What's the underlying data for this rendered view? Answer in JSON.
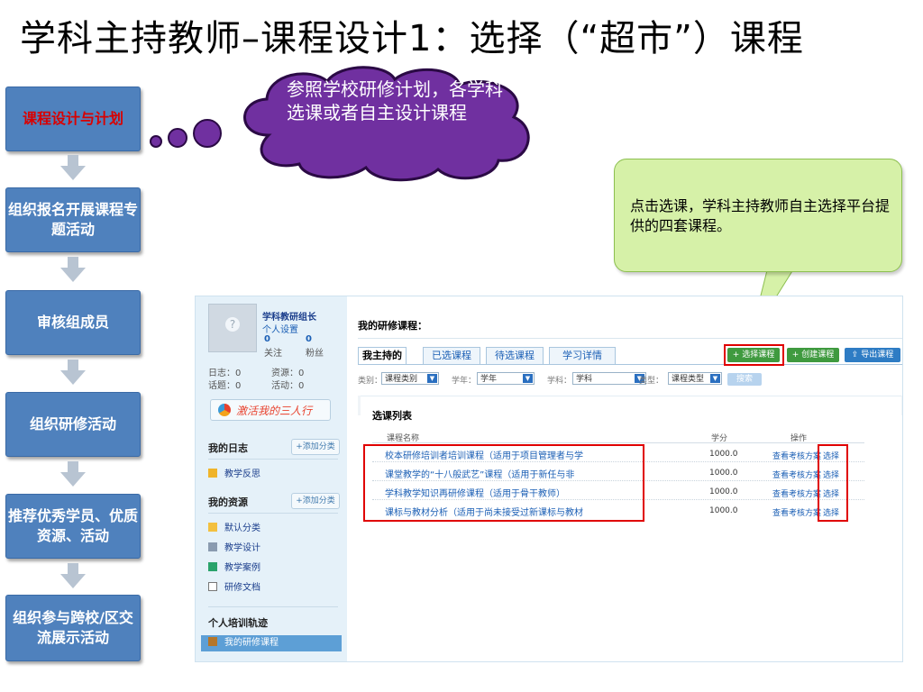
{
  "title": "学科主持教师–课程设计1：选择（“超市”）课程",
  "flow": [
    {
      "label": "课程设计与计划"
    },
    {
      "label": "组织报名开展课程专题活动"
    },
    {
      "label": "审核组成员"
    },
    {
      "label": "组织研修活动"
    },
    {
      "label": "推荐优秀学员、优质资源、活动"
    },
    {
      "label": "组织参与跨校/区交流展示活动"
    }
  ],
  "cloud_text": "参照学校研修计划，各学科选课或者自主设计课程",
  "callout_text": "点击选课，学科主持教师自主选择平台提供的四套课程。",
  "colors": {
    "flow_box": "#4f81bd",
    "cloud": "#7030a0",
    "callout": "#d6f1a8",
    "highlight": "#e00000"
  },
  "sidebar": {
    "user_name": "学科教研组长",
    "settings_link": "个人设置",
    "follow_count": "0",
    "follow_label": "关注",
    "fans_count": "0",
    "fans_label": "粉丝",
    "log_stat": "日志：0",
    "resource_stat": "资源：0",
    "topic_stat": "话题：0",
    "activity_stat": "活动：0",
    "activate_label": "激活我的三人行",
    "diary_heading": "我的日志",
    "add_category": "+添加分类",
    "diary_items": [
      "教学反思"
    ],
    "resource_heading": "我的资源",
    "resource_items": [
      "默认分类",
      "教学设计",
      "教学案例",
      "研修文档"
    ],
    "track_heading": "个人培训轨迹",
    "track_items": [
      "我的研修课程"
    ]
  },
  "main": {
    "page_title": "我的研修课程：",
    "tabs": [
      "我主持的",
      "已选课程",
      "待选课程",
      "学习详情"
    ],
    "buttons": [
      "+ 选择课程",
      "+ 创建课程",
      "导出课程"
    ],
    "filters": {
      "category_label": "类别：",
      "category_value": "课程类别",
      "year_label": "学年：",
      "year_value": "学年",
      "subject_label": "学科：",
      "subject_value": "学科",
      "type_label": "类型：",
      "type_value": "课程类型",
      "search_label": "搜索"
    },
    "list_title": "选课列表",
    "columns": [
      "课程名称",
      "学分",
      "操作"
    ],
    "courses": [
      {
        "name": "校本研修培训者培训课程（适用于项目管理者与学",
        "credit": "1000.0",
        "view": "查看考核方案",
        "pick": "选择"
      },
      {
        "name": "课堂教学的“十八般武艺”课程（适用于新任与非",
        "credit": "1000.0",
        "view": "查看考核方案",
        "pick": "选择"
      },
      {
        "name": "学科教学知识再研修课程（适用于骨干教师）",
        "credit": "1000.0",
        "view": "查看考核方案",
        "pick": "选择"
      },
      {
        "name": "课标与教材分析（适用于尚未接受过新课标与教材",
        "credit": "1000.0",
        "view": "查看考核方案",
        "pick": "选择"
      }
    ]
  }
}
